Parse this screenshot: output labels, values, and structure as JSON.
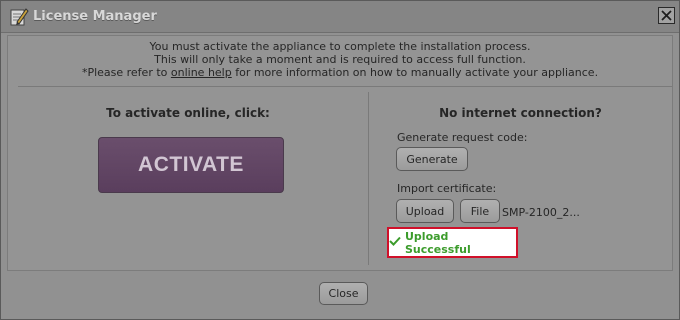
{
  "window": {
    "title": "License Manager"
  },
  "notice": {
    "line1": "You must activate the appliance to complete the installation process.",
    "line2": "This will only take a moment and is required to access full function.",
    "line3_prefix": "*Please refer to ",
    "line3_link": "online help",
    "line3_suffix": " for more information on how to manually activate your appliance."
  },
  "online": {
    "heading": "To activate online, click:",
    "activate_label": "ACTIVATE"
  },
  "offline": {
    "heading": "No internet connection?",
    "request_label": "Generate request code:",
    "generate_label": "Generate",
    "import_label": "Import certificate:",
    "upload_label": "Upload",
    "file_label": "File",
    "file_name": "SMP-2100_2..."
  },
  "status": {
    "message": "Upload Successful",
    "color": "#3c9c2c",
    "icon": "checkmark-icon"
  },
  "footer": {
    "close_label": "Close"
  },
  "colors": {
    "activate_button": "#634766",
    "success_border": "#d0102a"
  }
}
